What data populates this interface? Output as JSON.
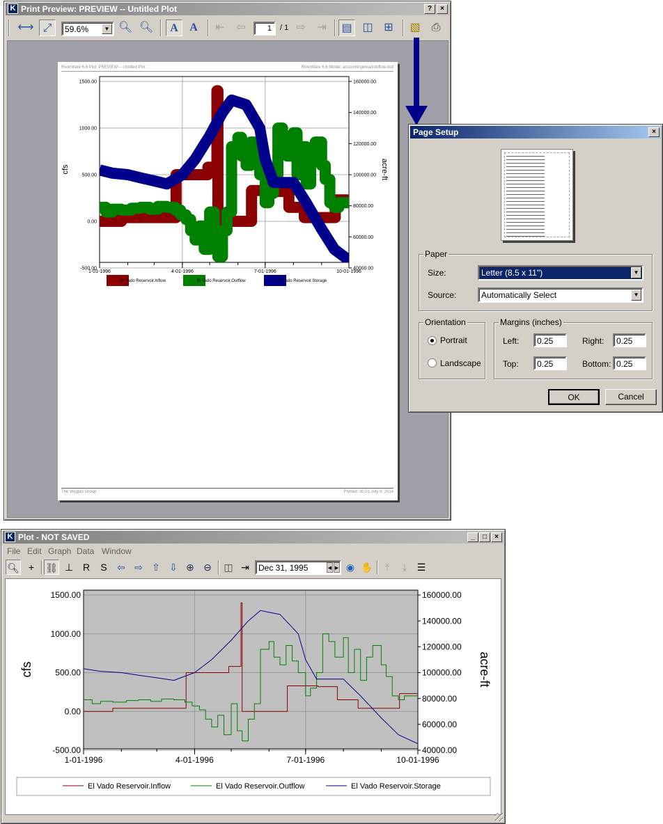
{
  "print_preview": {
    "title": "Print Preview: PREVIEW -- Untitled Plot",
    "help_btn": "?",
    "close_btn": "×",
    "zoom_value": "59.6%",
    "page_current": "1",
    "page_total": "/ 1",
    "page": {
      "header_left": "RiverWare 6.6 Plot: PREVIEW -- Untitled Plot",
      "header_right": "RiverWare 6.6 Model: accountingelvadoinflow.mdl",
      "footer_left": "The Wyglan Group",
      "footer_right": "Printed: 30.01 July 8, 2014"
    }
  },
  "page_setup": {
    "title": "Page Setup",
    "close_btn": "×",
    "paper_group": "Paper",
    "size_label": "Size:",
    "size_value": "Letter (8.5 x 11\")",
    "source_label": "Source:",
    "source_value": "Automatically Select",
    "orientation_group": "Orientation",
    "portrait_label": "Portrait",
    "landscape_label": "Landscape",
    "orientation_selected": "Portrait",
    "margins_group": "Margins (inches)",
    "left_label": "Left:",
    "left_value": "0.25",
    "right_label": "Right:",
    "right_value": "0.25",
    "top_label": "Top:",
    "top_value": "0.25",
    "bottom_label": "Bottom:",
    "bottom_value": "0.25",
    "ok_label": "OK",
    "cancel_label": "Cancel"
  },
  "plot_window": {
    "title": "Plot - NOT SAVED",
    "menu": [
      "File",
      "Edit",
      "Graph",
      "Data",
      "Window"
    ],
    "date_value": "Dec 31, 1995",
    "min_btn": "_",
    "max_btn": "□",
    "close_btn": "×"
  },
  "colors": {
    "inflow": "#8b0000",
    "outflow": "#008000",
    "storage": "#00008b",
    "plot_bg": "#c0c0c0",
    "title_inactive": "#808080",
    "title_active": "#0a246a"
  },
  "chart_data": {
    "type": "line",
    "title": "",
    "xlabel": "",
    "ylabel": "cfs",
    "y2label": "acre-ft",
    "x_ticks": [
      "1-01-1996",
      "4-01-1996",
      "7-01-1996",
      "10-01-1996"
    ],
    "x_domain": [
      "1996-01-01",
      "1996-10-01"
    ],
    "ylim": [
      -500,
      1500
    ],
    "y_ticks": [
      "1500.00",
      "1000.00",
      "500.00",
      "0.00",
      "-500.00"
    ],
    "y2lim": [
      40000,
      160000
    ],
    "y2_ticks": [
      "160000.00",
      "140000.00",
      "120000.00",
      "100000.00",
      "80000.00",
      "60000.00",
      "40000.00"
    ],
    "grid": true,
    "legend_position": "bottom",
    "series": [
      {
        "name": "El Vado Reservoir.Inflow",
        "axis": "left",
        "style": "step",
        "x": [
          "1996-01-01",
          "1996-01-24",
          "1996-01-25",
          "1996-03-24",
          "1996-03-25",
          "1996-04-28",
          "1996-04-29",
          "1996-05-09",
          "1996-05-10",
          "1996-05-13",
          "1996-06-15",
          "1996-06-16",
          "1996-07-10",
          "1996-07-11",
          "1996-07-26",
          "1996-07-27",
          "1996-08-12",
          "1996-08-13",
          "1996-09-15",
          "1996-09-16",
          "1996-10-07"
        ],
        "values": [
          0,
          0,
          40,
          40,
          500,
          500,
          580,
          1400,
          0,
          0,
          0,
          330,
          330,
          320,
          320,
          150,
          150,
          40,
          40,
          230,
          230
        ]
      },
      {
        "name": "El Vado Reservoir.Outflow",
        "axis": "left",
        "style": "step",
        "x": [
          "1996-01-01",
          "1996-01-08",
          "1996-01-15",
          "1996-01-25",
          "1996-02-05",
          "1996-02-15",
          "1996-02-25",
          "1996-03-05",
          "1996-03-15",
          "1996-03-24",
          "1996-03-30",
          "1996-04-05",
          "1996-04-10",
          "1996-04-15",
          "1996-04-20",
          "1996-04-25",
          "1996-05-01",
          "1996-05-06",
          "1996-05-10",
          "1996-05-15",
          "1996-05-20",
          "1996-05-25",
          "1996-06-01",
          "1996-06-05",
          "1996-06-10",
          "1996-06-15",
          "1996-06-20",
          "1996-06-25",
          "1996-07-01",
          "1996-07-05",
          "1996-07-10",
          "1996-07-15",
          "1996-07-20",
          "1996-07-25",
          "1996-08-01",
          "1996-08-05",
          "1996-08-10",
          "1996-08-15",
          "1996-08-20",
          "1996-08-25",
          "1996-09-01",
          "1996-09-05",
          "1996-09-10",
          "1996-09-15",
          "1996-09-20",
          "1996-10-01",
          "1996-10-07"
        ],
        "values": [
          150,
          100,
          130,
          120,
          140,
          150,
          130,
          160,
          150,
          120,
          70,
          20,
          -100,
          -200,
          -50,
          -300,
          100,
          -250,
          -380,
          -100,
          100,
          800,
          900,
          700,
          600,
          850,
          650,
          500,
          200,
          300,
          500,
          1000,
          900,
          700,
          950,
          500,
          800,
          400,
          700,
          850,
          600,
          450,
          200,
          150,
          200,
          200,
          300
        ]
      },
      {
        "name": "El Vado Reservoir.Storage",
        "axis": "right",
        "style": "line",
        "x": [
          "1996-01-01",
          "1996-01-15",
          "1996-02-01",
          "1996-02-15",
          "1996-03-01",
          "1996-03-15",
          "1996-04-01",
          "1996-04-15",
          "1996-05-01",
          "1996-05-15",
          "1996-05-25",
          "1996-06-10",
          "1996-06-25",
          "1996-07-01",
          "1996-07-10",
          "1996-07-20",
          "1996-08-01",
          "1996-08-15",
          "1996-09-01",
          "1996-09-15",
          "1996-10-01",
          "1996-10-07"
        ],
        "values": [
          103000,
          101000,
          100000,
          98000,
          96000,
          94000,
          100000,
          110000,
          125000,
          140000,
          148000,
          145000,
          130000,
          110000,
          95000,
          95000,
          95000,
          82000,
          65000,
          52000,
          45000,
          46000
        ]
      }
    ]
  }
}
